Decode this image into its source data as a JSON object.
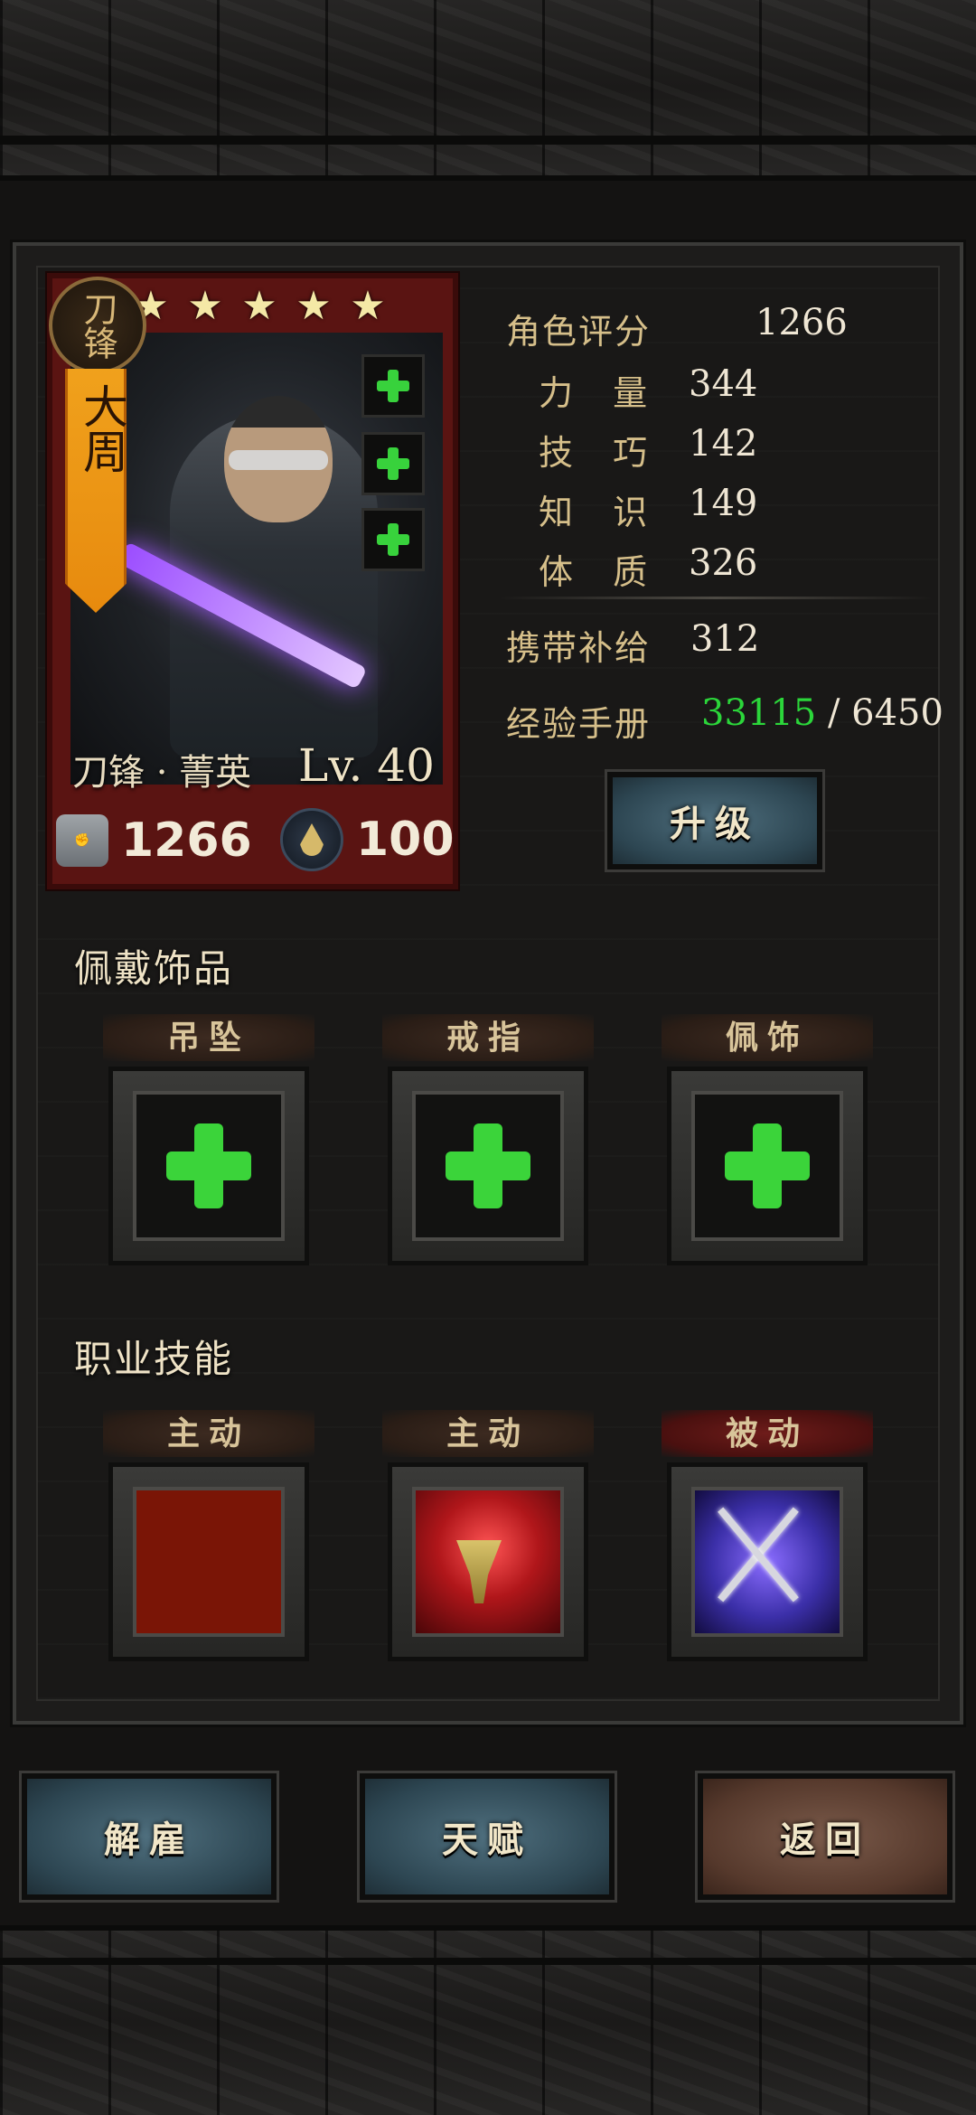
{
  "hero": {
    "class_badge": "刀锋",
    "banner": "大周",
    "stars": 5,
    "caption": "刀锋 · 菁英",
    "level": "Lv. 40",
    "power": "1266",
    "supply": "100"
  },
  "stats": {
    "rating_label": "角色评分",
    "rating_value": "1266",
    "strength_label": "力 量",
    "strength_value": "344",
    "skill_label": "技 巧",
    "skill_value": "142",
    "knowledge_label": "知 识",
    "knowledge_value": "149",
    "constitution_label": "体 质",
    "constitution_value": "326",
    "carry_label": "携带补给",
    "carry_value": "312",
    "exp_label": "经验手册",
    "exp_current": "33115",
    "exp_sep": " / ",
    "exp_required": "6450"
  },
  "buttons": {
    "upgrade": "升级",
    "dismiss": "解雇",
    "talent": "天赋",
    "back": "返回"
  },
  "accessories": {
    "title": "佩戴饰品",
    "slots": [
      "吊坠",
      "戒指",
      "佩饰"
    ]
  },
  "skills": {
    "title": "职业技能",
    "slots": [
      {
        "type": "主动",
        "icon": "flame-burst-icon"
      },
      {
        "type": "主动",
        "icon": "chalice-icon"
      },
      {
        "type": "被动",
        "icon": "crossed-swords-icon"
      }
    ]
  },
  "colors": {
    "exp_current": "#2bd63a",
    "plus": "#3bd43a",
    "card_bg": "#5a1412",
    "banner": "#f0a11c"
  }
}
